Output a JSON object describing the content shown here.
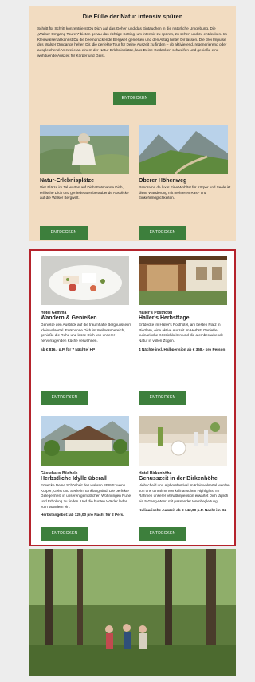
{
  "intro": {
    "title": "Die Fülle der Natur intensiv spüren",
    "text": "Schritt für Schritt konzentrierst Du Dich auf das Gehen und das Eintauchen in die natürliche Umgebung. Die „Walser Omgang Touren“ bieten genau das richtige Setting, um intensiv zu spüren, zu sehen und zu entdecken. Im Kleinwalsertal kannst Du die beeindruckende Bergwelt genießen und den Alltag hinter Dir lassen. Die drei Impulse des Walser Omgangs helfen Dir, die perfekte Tour für Deine Auszeit zu finden – ob aktivierend, regenerierend oder ausgleichend. Verweile an einem der Natur-Erlebnisplätze, lass Deine Gedanken schweifen und genieße eine wohltuende Auszeit für Körper und Geist.",
    "button": "ENTDECKEN"
  },
  "nature_tiles": [
    {
      "title": "Natur-Erlebnisplätze",
      "text": "Vier Plätze im Tal warten auf Dich! Entspanne Dich, erfrische Dich und genieße atemberaubende Ausblicke auf die Walser Bergwelt.",
      "button": "ENTDECKEN"
    },
    {
      "title": "Oberer Höhenweg",
      "text": "Panorama de luxe! Eine Wohltat für Körper und Seele ist diese Wanderung mit mehreren Rast- und Einkehrmöglichkeiten.",
      "button": "ENTDECKEN"
    }
  ],
  "hotels": [
    {
      "hotel": "Hotel Gemma",
      "title": "Wandern & Genießen",
      "text": "Genieße den Ausblick auf die traumhafte Bergkulisse im Kleinwalsertal. Entspanne Dich im Wellnessbereich, genieße die Ruhe und lasse Dich von unserer hervorragenden Küche verwöhnen.",
      "offer": "ab € 816,- p.P. für 7 Nächte/ HP",
      "button": "ENTDECKEN"
    },
    {
      "hotel": "Haller's Posthotel",
      "title": "Haller's Herbsttage",
      "text": "Entdecke im Haller's Posthotel, am besten Platz in Riezlern, eine aktive Auszeit im Herbst! Genieße kulinarische Köstlichkeiten und die atemberaubende Natur in vollen Zügen.",
      "offer": "4 Nächte inkl. Halbpension ab € 368,- pro Person",
      "button": "ENTDECKEN"
    },
    {
      "hotel": "Gästehaus Büchele",
      "title": "Herbstliche Idylle überall",
      "text": "Erwecke Deine Schönheit des wahren SEINS: wenn Körper, Geist und Seele im Einklang sind. Die perfekte Gelegenheit, in unseren gemütlichen Wohnungen Ruhe und Erholung zu finden. Und die bunten Wälder laden zum Wandern ein.",
      "offer": "Herbstangebot: ab 120,00 pro Nacht für 2 Pers.",
      "button": "ENTDECKEN"
    },
    {
      "hotel": "Hotel Birkenhöhe",
      "title": "Genusszeit in der Birkenhöhe",
      "text": "Viehscheid und Alphornfestival im Kleinwalsertal werden von uns umrahmt von kulinarischen Highlights. Im Rahmen unserer Verwöhnpension erwartet Dich täglich ein 5-Gang-Menü mit passender Weinbegleitung.",
      "offer": "Kulinarische Auszeit ab € 142,00 p.P. Nacht im DZ",
      "button": "ENTDECKEN"
    }
  ],
  "colors": {
    "accent_green": "#3d7f3c",
    "intro_bg": "#f2dcc1",
    "highlight_border": "#b5232c"
  }
}
